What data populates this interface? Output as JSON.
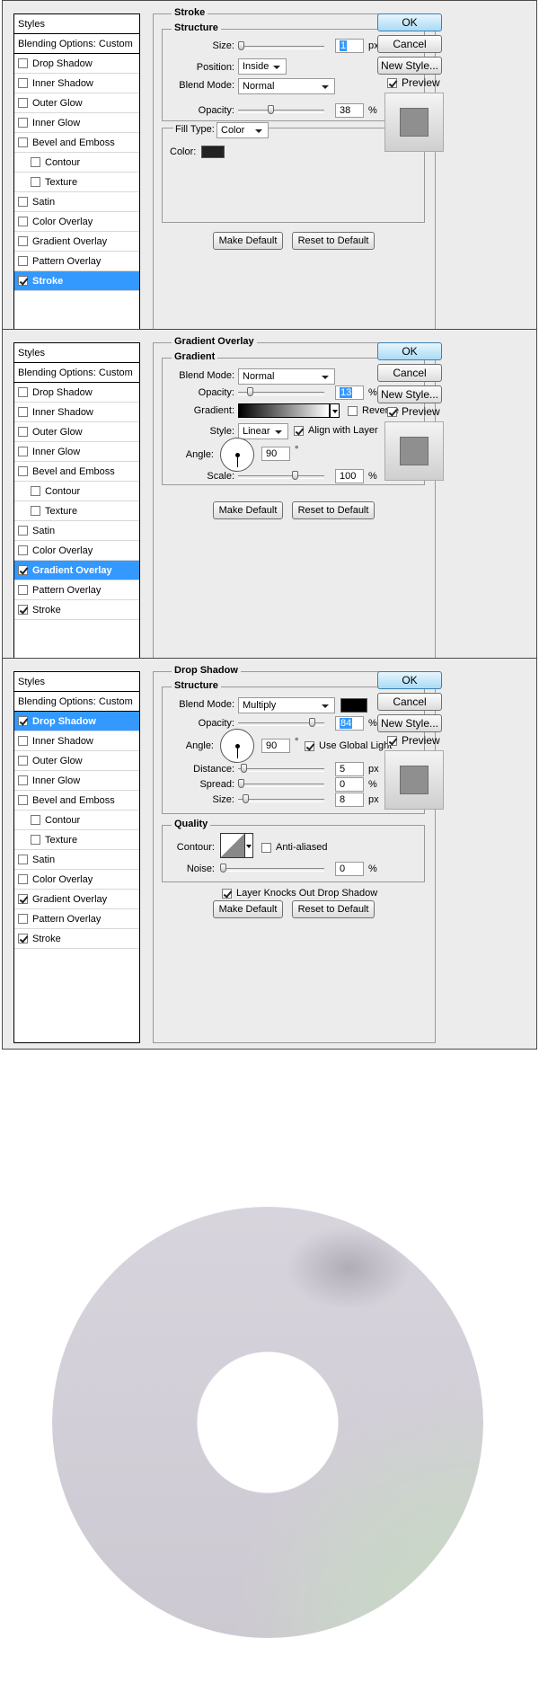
{
  "buttons": {
    "ok": "OK",
    "cancel": "Cancel",
    "new_style": "New Style...",
    "preview": "Preview",
    "make_default": "Make Default",
    "reset_to_default": "Reset to Default"
  },
  "styles_panel": {
    "header": "Styles",
    "blending": "Blending Options: Custom",
    "items": [
      "Drop Shadow",
      "Inner Shadow",
      "Outer Glow",
      "Inner Glow",
      "Bevel and Emboss",
      "Contour",
      "Texture",
      "Satin",
      "Color Overlay",
      "Gradient Overlay",
      "Pattern Overlay",
      "Stroke"
    ]
  },
  "dialog1": {
    "checked": [
      "Stroke"
    ],
    "selected": "Stroke",
    "title": "Stroke",
    "structure": "Structure",
    "size_label": "Size:",
    "size_value": "1",
    "size_unit": "px",
    "size_fraction": 0.0,
    "position_label": "Position:",
    "position_value": "Inside",
    "blend_label": "Blend Mode:",
    "blend_value": "Normal",
    "opacity_label": "Opacity:",
    "opacity_value": "38",
    "opacity_unit": "%",
    "fill_type_label": "Fill Type:",
    "fill_type_value": "Color",
    "color_label": "Color:",
    "color_hex": "#222222"
  },
  "dialog2": {
    "checked": [
      "Gradient Overlay",
      "Stroke"
    ],
    "selected": "Gradient Overlay",
    "title": "Gradient Overlay",
    "group": "Gradient",
    "blend_label": "Blend Mode:",
    "blend_value": "Normal",
    "opacity_label": "Opacity:",
    "opacity_value": "13",
    "opacity_unit": "%",
    "gradient_label": "Gradient:",
    "reverse_label": "Reverse",
    "style_label": "Style:",
    "style_value": "Linear",
    "align_label": "Align with Layer",
    "angle_label": "Angle:",
    "angle_value": "90",
    "angle_unit": "°",
    "scale_label": "Scale:",
    "scale_value": "100",
    "scale_unit": "%"
  },
  "dialog3": {
    "checked": [
      "Drop Shadow",
      "Gradient Overlay",
      "Stroke"
    ],
    "selected": "Drop Shadow",
    "title": "Drop Shadow",
    "structure": "Structure",
    "blend_label": "Blend Mode:",
    "blend_value": "Multiply",
    "shadow_color": "#000000",
    "opacity_label": "Opacity:",
    "opacity_value": "84",
    "opacity_unit": "%",
    "angle_label": "Angle:",
    "angle_value": "90",
    "angle_unit": "°",
    "global_light": "Use Global Light",
    "distance_label": "Distance:",
    "distance_value": "5",
    "distance_unit": "px",
    "spread_label": "Spread:",
    "spread_value": "0",
    "spread_unit": "%",
    "size_label": "Size:",
    "size_value": "8",
    "size_unit": "px",
    "quality": "Quality",
    "contour_label": "Contour:",
    "anti_aliased": "Anti-aliased",
    "noise_label": "Noise:",
    "noise_value": "0",
    "noise_unit": "%",
    "knockout": "Layer Knocks Out Drop Shadow"
  },
  "colors": {
    "accent": "#3399ff",
    "dialog_bg": "#ececec",
    "disc": "#cfcbd4",
    "disc_highlight": "#c8dac4"
  }
}
